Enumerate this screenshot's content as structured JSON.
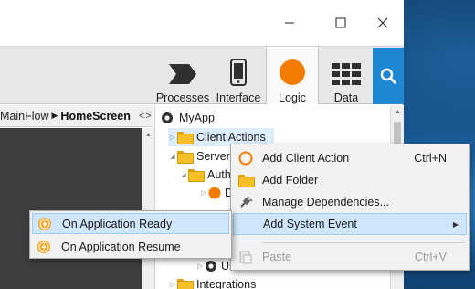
{
  "toolbar": {
    "processes_label": "Processes",
    "interface_label": "Interface",
    "logic_label": "Logic",
    "data_label": "Data"
  },
  "breadcrumb": {
    "flow": "MainFlow",
    "separator": "▶",
    "screen": "HomeScreen",
    "nav": "<>"
  },
  "tree": {
    "root": "MyApp",
    "client_actions": "Client Actions",
    "server_actions_partial": "Server A",
    "auth_partial": "Auth",
    "d_partial": "D",
    "users_partial": "User",
    "integrations": "Integrations"
  },
  "context_menu": {
    "items": [
      {
        "label": "Add Client Action",
        "shortcut": "Ctrl+N"
      },
      {
        "label": "Add Folder",
        "shortcut": ""
      },
      {
        "label": "Manage Dependencies...",
        "shortcut": ""
      },
      {
        "label": "Add System Event",
        "shortcut": ""
      },
      {
        "label": "Paste",
        "shortcut": "Ctrl+V"
      }
    ]
  },
  "submenu": {
    "items": [
      {
        "label": "On Application Ready"
      },
      {
        "label": "On Application Resume"
      }
    ]
  },
  "colors": {
    "logic_accent": "#f57c00",
    "search_button": "#1e88d2",
    "menu_highlight": "#cfe6fb",
    "folder": "#f5bf2a"
  }
}
